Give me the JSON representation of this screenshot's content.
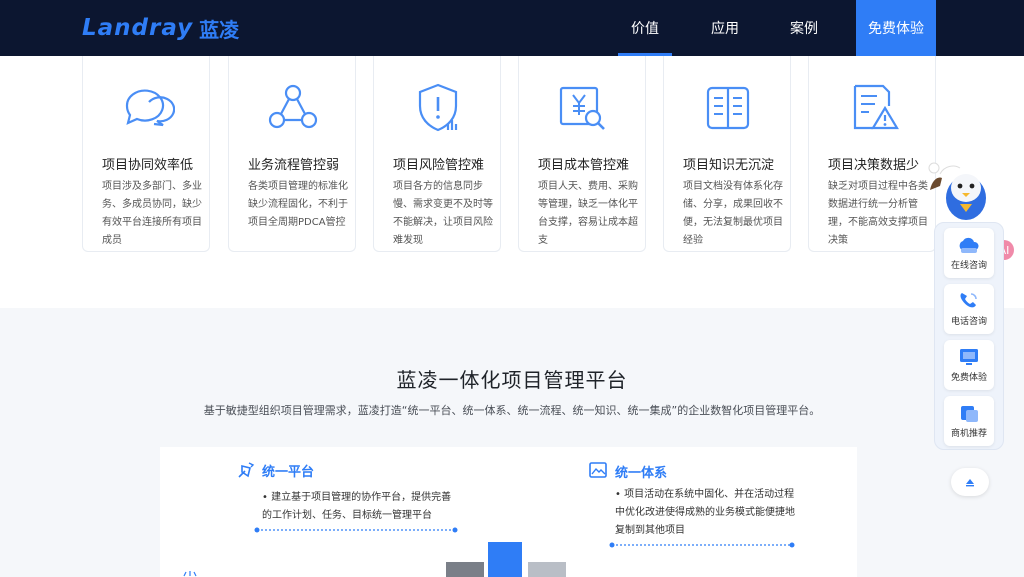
{
  "header": {
    "logo_en": "Landray",
    "logo_cn": "蓝凌",
    "nav": [
      {
        "label": "价值",
        "active": true
      },
      {
        "label": "应用",
        "active": false
      },
      {
        "label": "案例",
        "active": false
      }
    ],
    "trial_label": "免费体验"
  },
  "pain_cards": [
    {
      "title": "项目协同效率低",
      "desc": "项目涉及多部门、多业务、多成员协同，缺少有效平台连接所有项目成员",
      "icon": "chat-bubbles-icon"
    },
    {
      "title": "业务流程管控弱",
      "desc": "各类项目管理的标准化缺少流程固化，不利于项目全周期PDCA管控",
      "icon": "process-nodes-icon"
    },
    {
      "title": "项目风险管控难",
      "desc": "项目各方的信息同步慢、需求变更不及时等不能解决，让项目风险难发现",
      "icon": "shield-alert-icon"
    },
    {
      "title": "项目成本管控难",
      "desc": "项目人天、费用、采购等管理，缺乏一体化平台支撑，容易让成本超支",
      "icon": "cost-search-icon"
    },
    {
      "title": "项目知识无沉淀",
      "desc": "项目文档没有体系化存储、分享，成果回收不便，无法复制最优项目经验",
      "icon": "book-icon"
    },
    {
      "title": "项目决策数据少",
      "desc": "缺乏对项目过程中各类数据进行统一分析管理，不能高效支撑项目决策",
      "icon": "report-warning-icon"
    }
  ],
  "platform": {
    "title": "蓝凌一体化项目管理平台",
    "subtitle": "基于敏捷型组织项目管理需求，蓝凌打造“统一平台、统一体系、统一流程、统一知识、统一集成”的企业数智化项目管理平台。",
    "features": [
      {
        "title": "统一平台",
        "desc": "•  建立基于项目管理的协作平台，提供完善的工作计划、任务、目标统一管理平台",
        "icon": "hand-flag-icon"
      },
      {
        "title": "统一体系",
        "desc": "•  项目活动在系统中固化、并在活动过程中优化改进使得成熟的业务模式能便捷地复制到其他项目",
        "icon": "image-frame-icon"
      }
    ]
  },
  "float": {
    "items": [
      {
        "label": "在线咨询",
        "icon": "cloud-chat-icon"
      },
      {
        "label": "电话咨询",
        "icon": "phone-icon"
      },
      {
        "label": "免费体验",
        "icon": "monitor-icon"
      },
      {
        "label": "商机推荐",
        "icon": "cards-icon"
      }
    ],
    "ai_badge": "AI",
    "mascot": "mascot-icon",
    "top": "back-to-top-icon"
  },
  "colors": {
    "brand": "#2f7df6",
    "header_bg": "#0c1630",
    "icon_blue": "#4a8ef5"
  }
}
